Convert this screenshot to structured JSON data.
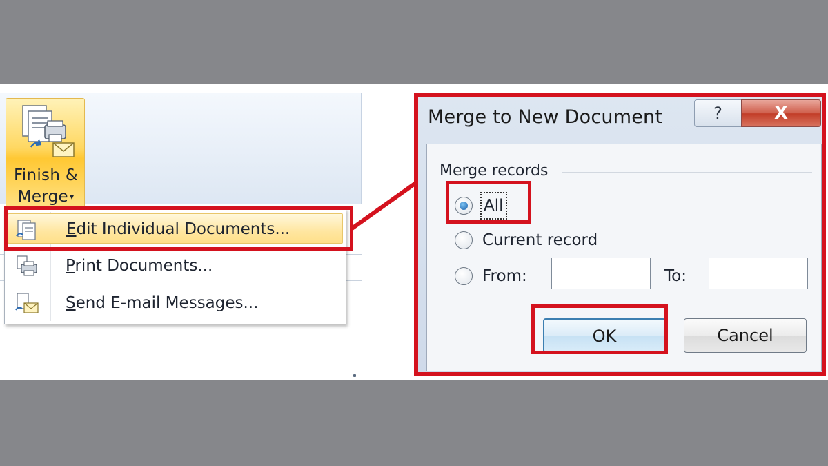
{
  "ribbon": {
    "finish_merge_line1": "Finish &",
    "finish_merge_line2": "Merge",
    "menu_items": [
      {
        "label": "Edit Individual Documents...",
        "mnemonic": "E",
        "icon": "edit-documents-icon",
        "highlighted": true
      },
      {
        "label": "Print Documents...",
        "mnemonic": "P",
        "icon": "print-documents-icon",
        "highlighted": false
      },
      {
        "label": "Send E-mail Messages...",
        "mnemonic": "S",
        "icon": "email-messages-icon",
        "highlighted": false
      }
    ]
  },
  "dialog": {
    "title": "Merge to New Document",
    "help_glyph": "?",
    "close_glyph": "X",
    "group_label": "Merge records",
    "options": {
      "all": "All",
      "current": "Current record",
      "from": "From:"
    },
    "selected_option": "all",
    "from_value": "",
    "to_label": "To:",
    "to_value": "",
    "ok_label": "OK",
    "cancel_label": "Cancel"
  },
  "colors": {
    "highlight_red": "#d4121e",
    "background_gray": "#86878b",
    "finish_button_gold": "#ffd862"
  }
}
